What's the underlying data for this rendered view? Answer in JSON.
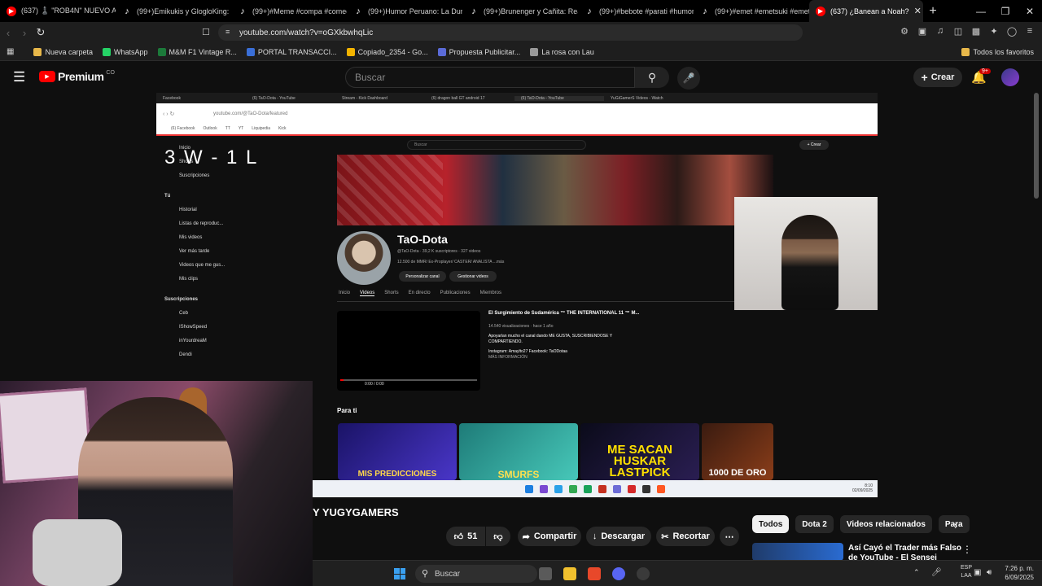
{
  "browser": {
    "tabs": [
      {
        "label": "(637) ♟️ \"ROB4N\" NUEVO AU",
        "icon": "youtube-icon"
      },
      {
        "label": "(99+)Emikukis y GlogloKing: M",
        "icon": "tiktok-icon"
      },
      {
        "label": "(99+)#Meme #compa #comedi",
        "icon": "tiktok-icon"
      },
      {
        "label": "(99+)Humor Peruano: La Dura",
        "icon": "tiktok-icon"
      },
      {
        "label": "(99+)Brunenger y Cañita: Reac",
        "icon": "tiktok-icon"
      },
      {
        "label": "(99+)#bebote #parati #humor",
        "icon": "tiktok-icon"
      },
      {
        "label": "(99+)#emet #emetsuki #emets",
        "icon": "tiktok-icon"
      },
      {
        "label": "(637) ¿Banean a Noah?",
        "icon": "youtube-icon",
        "active": true
      }
    ],
    "url": "youtube.com/watch?v=oGXkbwhqLic",
    "bookmarks": [
      {
        "label": "Nueva carpeta",
        "color": "#e8b84a"
      },
      {
        "label": "WhatsApp",
        "color": "#25d366"
      },
      {
        "label": "M&M F1 Vintage R...",
        "color": "#1c7a3a"
      },
      {
        "label": "PORTAL TRANSACCI...",
        "color": "#3a6fd8"
      },
      {
        "label": "Copiado_2354 - Go...",
        "color": "#f4b400"
      },
      {
        "label": "Propuesta Publicitar...",
        "color": "#5b6bd8"
      },
      {
        "label": "La rosa con Lau",
        "color": "#999999"
      }
    ],
    "favorites": "Todos los favoritos"
  },
  "youtube": {
    "logo": "Premium",
    "logo_suffix": "CO",
    "search_placeholder": "Buscar",
    "create_label": "Crear",
    "notif_count": "9+",
    "channel_title": "Y YUGYGAMERS",
    "likes": "51",
    "share_label": "Compartir",
    "download_label": "Descargar",
    "clip_label": "Recortar",
    "chips": [
      "Todos",
      "Dota 2",
      "Videos relacionados",
      "Para"
    ],
    "rec_title": "Así Cayó el Trader más Falso de YouTube - El Sensei"
  },
  "stream": {
    "overlay_text": "3 W - 1 L",
    "inner_tabs": [
      "Facebook",
      "(6) TaO-Dota - YouTube",
      "Stream - Kick Dashboard",
      "(6) dragon ball GT android 17",
      "(6) TaO-Dota - YouTube",
      "YuGiGamerS Videos - Watch"
    ],
    "inner_url": "youtube.com/@TaO-Dota/featured",
    "inner_bookmarks": [
      "(6) Facebook",
      "Outlook",
      "TT",
      "YT",
      "Liquipedia",
      "Kick"
    ],
    "inner_search": "Buscar",
    "inner_crear": "+ Crear",
    "side": [
      "Inicio",
      "Shorts",
      "Suscripciones",
      "Tú",
      "Historial",
      "Listas de reproduc...",
      "Mis videos",
      "Ver más tarde",
      "Videos que me gus...",
      "Mis clips",
      "Suscripciones",
      "Ceb",
      "IShowSpeed",
      "inYourdreaM",
      "Dendi"
    ],
    "channel_name": "TaO-Dota",
    "channel_meta": "@TaO-Dota · 39,2 K suscriptores · 327 videos",
    "channel_desc": "12.500 de MMR/ Ex-Proplayer/ CASTER/ ANALISTA ...más",
    "btn_customize": "Personalizar canal",
    "btn_manage": "Gestionar videos",
    "tabs": [
      "Inicio",
      "Videos",
      "Shorts",
      "En directo",
      "Publicaciones",
      "Miembros"
    ],
    "featured_title": "El Surgimiento de Sudamérica ™ THE INTERNATIONAL 11 ™ M...",
    "featured_views": "14.540 visualizaciones · hace 1 año",
    "featured_desc": "Apoyarlan mucho el canal dando ME GUSTA, SUSCRIBIENDOSE Y COMPARTIENDO.",
    "featured_links": "Instagram: Amaylto27 Facebook: TaODotaa",
    "featured_more": "MÁS INFORMACIÓN",
    "player_time": "0:00 / 0:00",
    "para_ti": "Para ti",
    "thumbs": [
      {
        "text": "MIS PREDICCIONES",
        "color": "#ffd84a"
      },
      {
        "text": "SMURFS",
        "color": "#ffe14f"
      },
      {
        "text": "ME SACAN HUSKAR LASTPICK",
        "color": "#ffe000"
      },
      {
        "text": "1000 DE ORO",
        "color": "#ffffff"
      }
    ],
    "inner_clock": "8:10",
    "inner_date": "02/09/2025"
  },
  "taskbar": {
    "search": "Buscar",
    "lang": "ESP",
    "lang2": "LAA",
    "time": "7:26 p. m.",
    "date": "6/09/2025"
  }
}
